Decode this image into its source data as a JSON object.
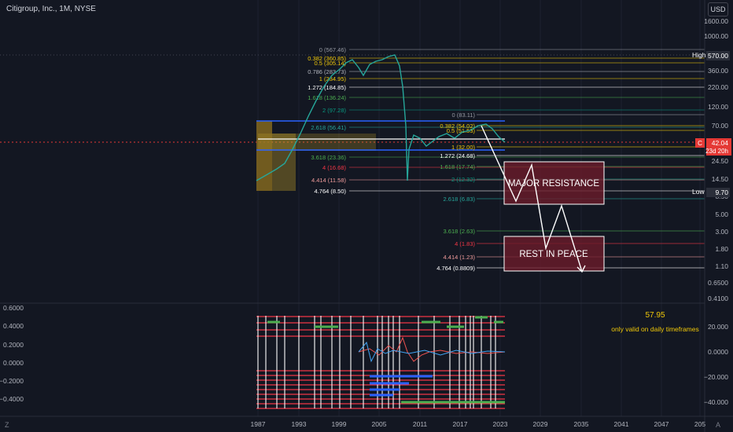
{
  "header": {
    "title": "Citigroup, Inc., 1M, NYSE",
    "currency_button": "USD"
  },
  "colors": {
    "background": "#131722",
    "grid": "#2a2e39",
    "text": "#d1d4dc",
    "price_red": "#e53935",
    "fib_blue": "#2962ff",
    "resistance_fill": "#6b1b2a",
    "gold": "#c9a227"
  },
  "price_axis": {
    "ticks": [
      "1600.00",
      "1000.00",
      "570.00",
      "360.00",
      "220.00",
      "120.00",
      "70.00",
      "42.04",
      "24.50",
      "14.50",
      "8.50",
      "5.00",
      "3.00",
      "1.80",
      "1.10",
      "0.6500",
      "0.4100"
    ],
    "high_label": "High",
    "high_value": "570.00",
    "last_prefix": "C",
    "last_value": "42.04",
    "countdown": "23d 20h",
    "low_label": "Low",
    "low_value": "9.70"
  },
  "time_axis": [
    "1987",
    "1993",
    "1999",
    "2005",
    "2011",
    "2017",
    "2023",
    "2029",
    "2035",
    "2041",
    "2047",
    "205"
  ],
  "fib_set_1": [
    {
      "label": "0 (567.46)",
      "color": "#9598a1"
    },
    {
      "label": "0.382 (360.85)",
      "color": "#f0c808"
    },
    {
      "label": "0.5 (305.14)",
      "color": "#f0c808"
    },
    {
      "label": "0.786 (283.73)",
      "color": "#b2b5be"
    },
    {
      "label": "1 (234.95)",
      "color": "#f0c808"
    },
    {
      "label": "1.272 (184.85)",
      "color": "#ffffff"
    },
    {
      "label": "1.618 (136.24)",
      "color": "#4caf50"
    },
    {
      "label": "2 (97.28)",
      "color": "#089981"
    },
    {
      "label": "2.618 (56.41)",
      "color": "#26a69a"
    },
    {
      "label": "3.618 (23.36)",
      "color": "#4caf50"
    },
    {
      "label": "4 (16.68)",
      "color": "#f23645"
    },
    {
      "label": "4.414 (11.58)",
      "color": "#ef9a9a"
    },
    {
      "label": "4.764 (8.50)",
      "color": "#ffffff"
    }
  ],
  "fib_set_2": [
    {
      "label": "0 (83.11)",
      "color": "#9598a1"
    },
    {
      "label": "0.382 (54.02)",
      "color": "#f0c808"
    },
    {
      "label": "0.5 (51.53)",
      "color": "#f0c808"
    },
    {
      "label": "1 (32.00)",
      "color": "#f0c808"
    },
    {
      "label": "1.272 (24.68)",
      "color": "#ffffff"
    },
    {
      "label": "1.618 (17.74)",
      "color": "#4caf50"
    },
    {
      "label": "2 (12.32)",
      "color": "#089981"
    },
    {
      "label": "2.618 (6.83)",
      "color": "#26a69a"
    },
    {
      "label": "3.618 (2.63)",
      "color": "#4caf50"
    },
    {
      "label": "4 (1.83)",
      "color": "#f23645"
    },
    {
      "label": "4.414 (1.23)",
      "color": "#ef9a9a"
    },
    {
      "label": "4.764 (0.8809)",
      "color": "#ffffff"
    }
  ],
  "annotations": {
    "major_resistance": "MAJOR RESISTANCE",
    "rest_in_peace": "REST IN PEACE"
  },
  "indicator": {
    "left_ticks": [
      "0.6000",
      "0.4000",
      "0.2000",
      "0.0000",
      "−0.2000",
      "−0.4000"
    ],
    "right_ticks": [
      "20.000",
      "0.0000",
      "−20.000",
      "−40.000"
    ],
    "value": "57.95",
    "note": "only valid on daily timeframes"
  },
  "footer": {
    "z_button": "Z",
    "a_button": "A"
  }
}
